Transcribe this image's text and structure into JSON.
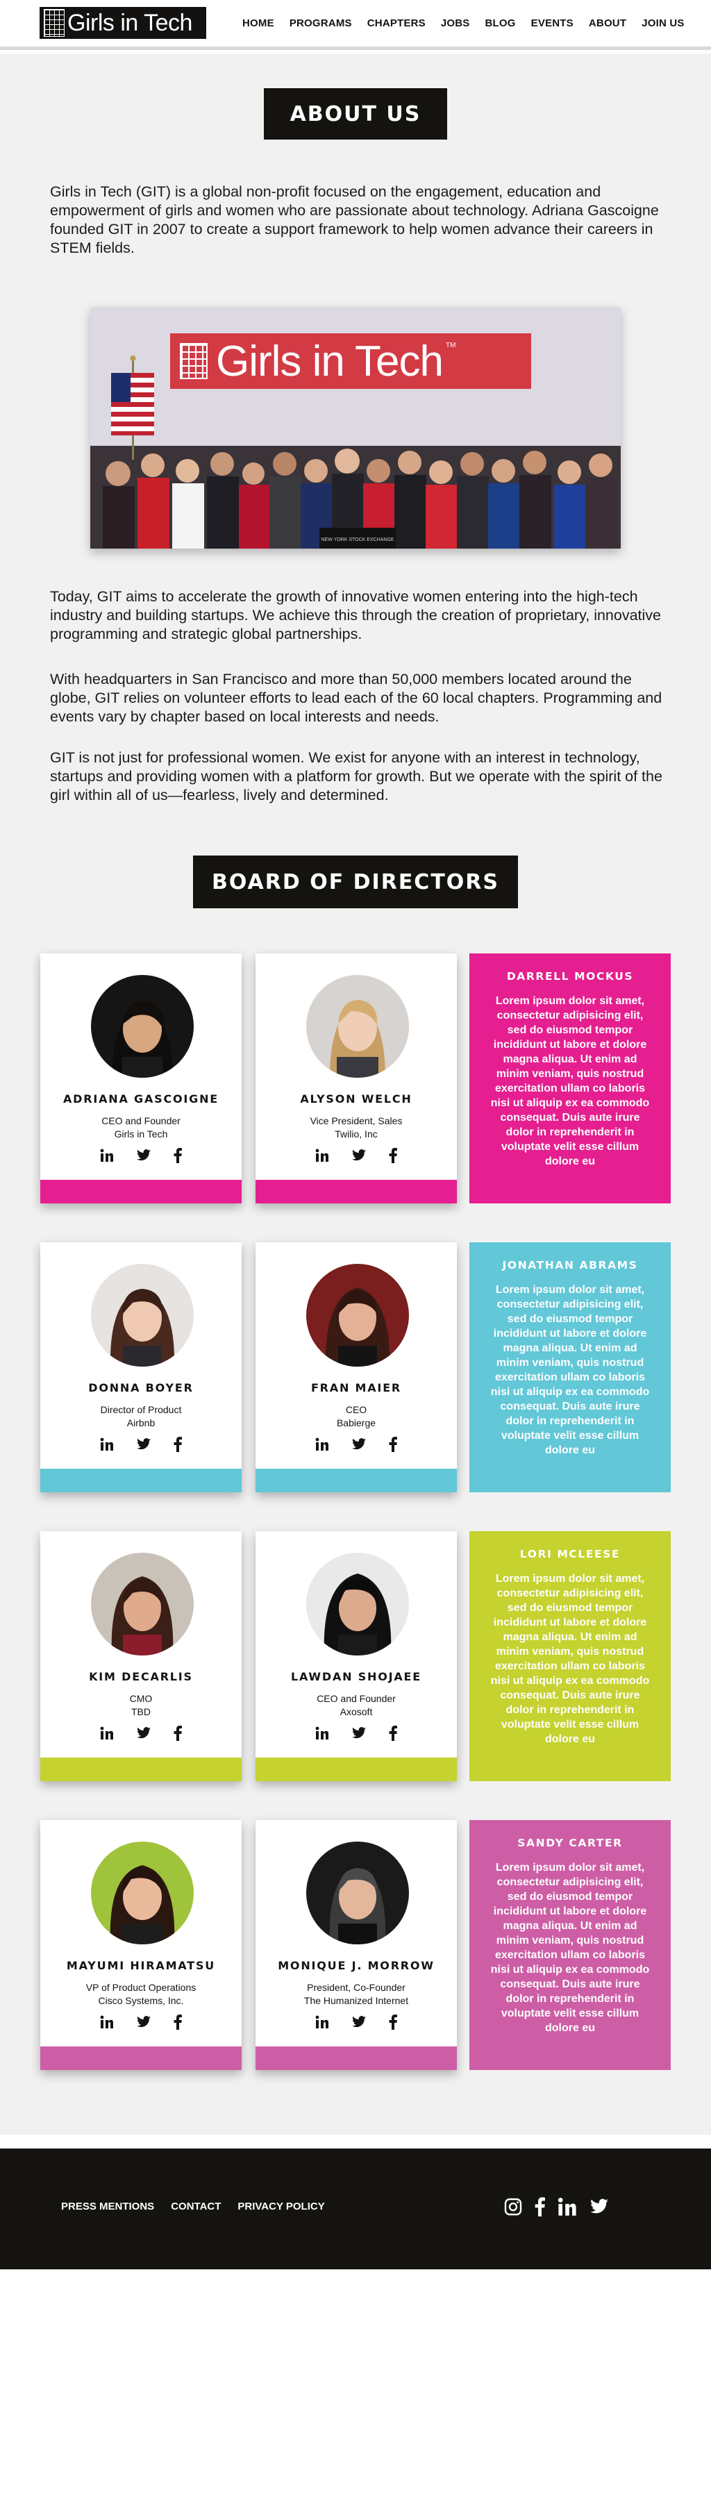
{
  "header": {
    "logo_text": "Girls in Tech",
    "nav": [
      "HOME",
      "PROGRAMS",
      "CHAPTERS",
      "JOBS",
      "BLOG",
      "EVENTS",
      "ABOUT",
      "JOIN US"
    ]
  },
  "about": {
    "title": "ABOUT US",
    "intro": "Girls in Tech (GIT) is a global non-profit focused on the engagement, education and empowerment of girls and women who are passionate about technology. Adriana Gascoigne founded GIT in 2007 to create a support framework to help women advance their careers in STEM fields.",
    "photo_banner": "Girls in Tech",
    "photo_banner_tm": "TM",
    "photo_podium_sign": "NEW YORK STOCK EXCHANGE",
    "p2": "Today, GIT aims to accelerate the growth of innovative women entering into the high-tech industry and building startups. We achieve this through the creation of proprietary, innovative programming and strategic global partnerships.",
    "p3": "With headquarters in San Francisco and more than 50,000 members located around the globe, GIT relies on volunteer efforts to lead each of the 60 local chapters. Programming and events vary by chapter based on local interests and needs.",
    "p4": "GIT is not just for professional women. We exist for anyone with an interest in technology, startups and providing women with a platform for growth. But we operate with the spirit of the girl within all of us—fearless, lively and determined."
  },
  "board": {
    "title": "BOARD OF DIRECTORS",
    "rows": [
      {
        "accent": "#e51f8f",
        "members": [
          {
            "name": "ADRIANA GASCOIGNE",
            "role1": "CEO and Founder",
            "role2": "Girls in Tech"
          },
          {
            "name": "ALYSON WELCH",
            "role1": "Vice President, Sales",
            "role2": "Twilio, Inc"
          }
        ],
        "bio": {
          "name": "DARRELL MOCKUS",
          "text": "Lorem ipsum dolor sit amet, consectetur adipisicing elit, sed do eiusmod tempor incididunt ut labore et dolore magna aliqua. Ut enim ad minim veniam, quis nostrud exercitation ullam co laboris nisi ut aliquip ex ea commodo consequat. Duis aute irure dolor in reprehenderit in voluptate velit esse cillum dolore eu"
        }
      },
      {
        "accent": "#62c7d7",
        "members": [
          {
            "name": "DONNA BOYER",
            "role1": "Director of Product",
            "role2": "Airbnb"
          },
          {
            "name": "FRAN MAIER",
            "role1": "CEO",
            "role2": "Babierge"
          }
        ],
        "bio": {
          "name": "JONATHAN ABRAMS",
          "text": "Lorem ipsum dolor sit amet, consectetur adipisicing elit, sed do eiusmod tempor incididunt ut labore et dolore magna aliqua. Ut enim ad minim veniam, quis nostrud exercitation ullam co laboris nisi ut aliquip ex ea commodo consequat. Duis aute irure dolor in reprehenderit in voluptate velit esse cillum dolore eu"
        }
      },
      {
        "accent": "#c5d22f",
        "members": [
          {
            "name": "KIM DECARLIS",
            "role1": "CMO",
            "role2": "TBD"
          },
          {
            "name": "LAWDAN SHOJAEE",
            "role1": "CEO and Founder",
            "role2": "Axosoft"
          }
        ],
        "bio": {
          "name": "LORI MCLEESE",
          "text": "Lorem ipsum dolor sit amet, consectetur adipisicing elit, sed do eiusmod tempor incididunt ut labore et dolore magna aliqua. Ut enim ad minim veniam, quis nostrud exercitation ullam co laboris nisi ut aliquip ex ea commodo consequat. Duis aute irure dolor in reprehenderit in voluptate velit esse cillum dolore eu"
        }
      },
      {
        "accent": "#cd5ea5",
        "members": [
          {
            "name": "MAYUMI HIRAMATSU",
            "role1": "VP of Product Operations",
            "role2": "Cisco Systems, Inc."
          },
          {
            "name": "MONIQUE J. MORROW",
            "role1": "President, Co-Founder",
            "role2": "The Humanized Internet"
          }
        ],
        "bio": {
          "name": "SANDY CARTER",
          "text": "Lorem ipsum dolor sit amet, consectetur adipisicing elit, sed do eiusmod tempor incididunt ut labore et dolore magna aliqua. Ut enim ad minim veniam, quis nostrud exercitation ullam co laboris nisi ut aliquip ex ea commodo consequat. Duis aute irure dolor in reprehenderit in voluptate velit esse cillum dolore eu"
        }
      }
    ],
    "card_icons": [
      "linkedin-icon",
      "twitter-icon",
      "facebook-icon"
    ]
  },
  "footer": {
    "links": [
      "PRESS MENTIONS",
      "CONTACT",
      "PRIVACY POLICY"
    ],
    "social_icons": [
      "instagram-icon",
      "facebook-icon",
      "linkedin-icon",
      "twitter-icon"
    ]
  },
  "colors": {
    "dark": "#151310",
    "page_grey": "#f1f1f1",
    "pink": "#e51f8f",
    "teal": "#62c7d7",
    "lime": "#c5d22f",
    "magenta": "#cd5ea5"
  }
}
